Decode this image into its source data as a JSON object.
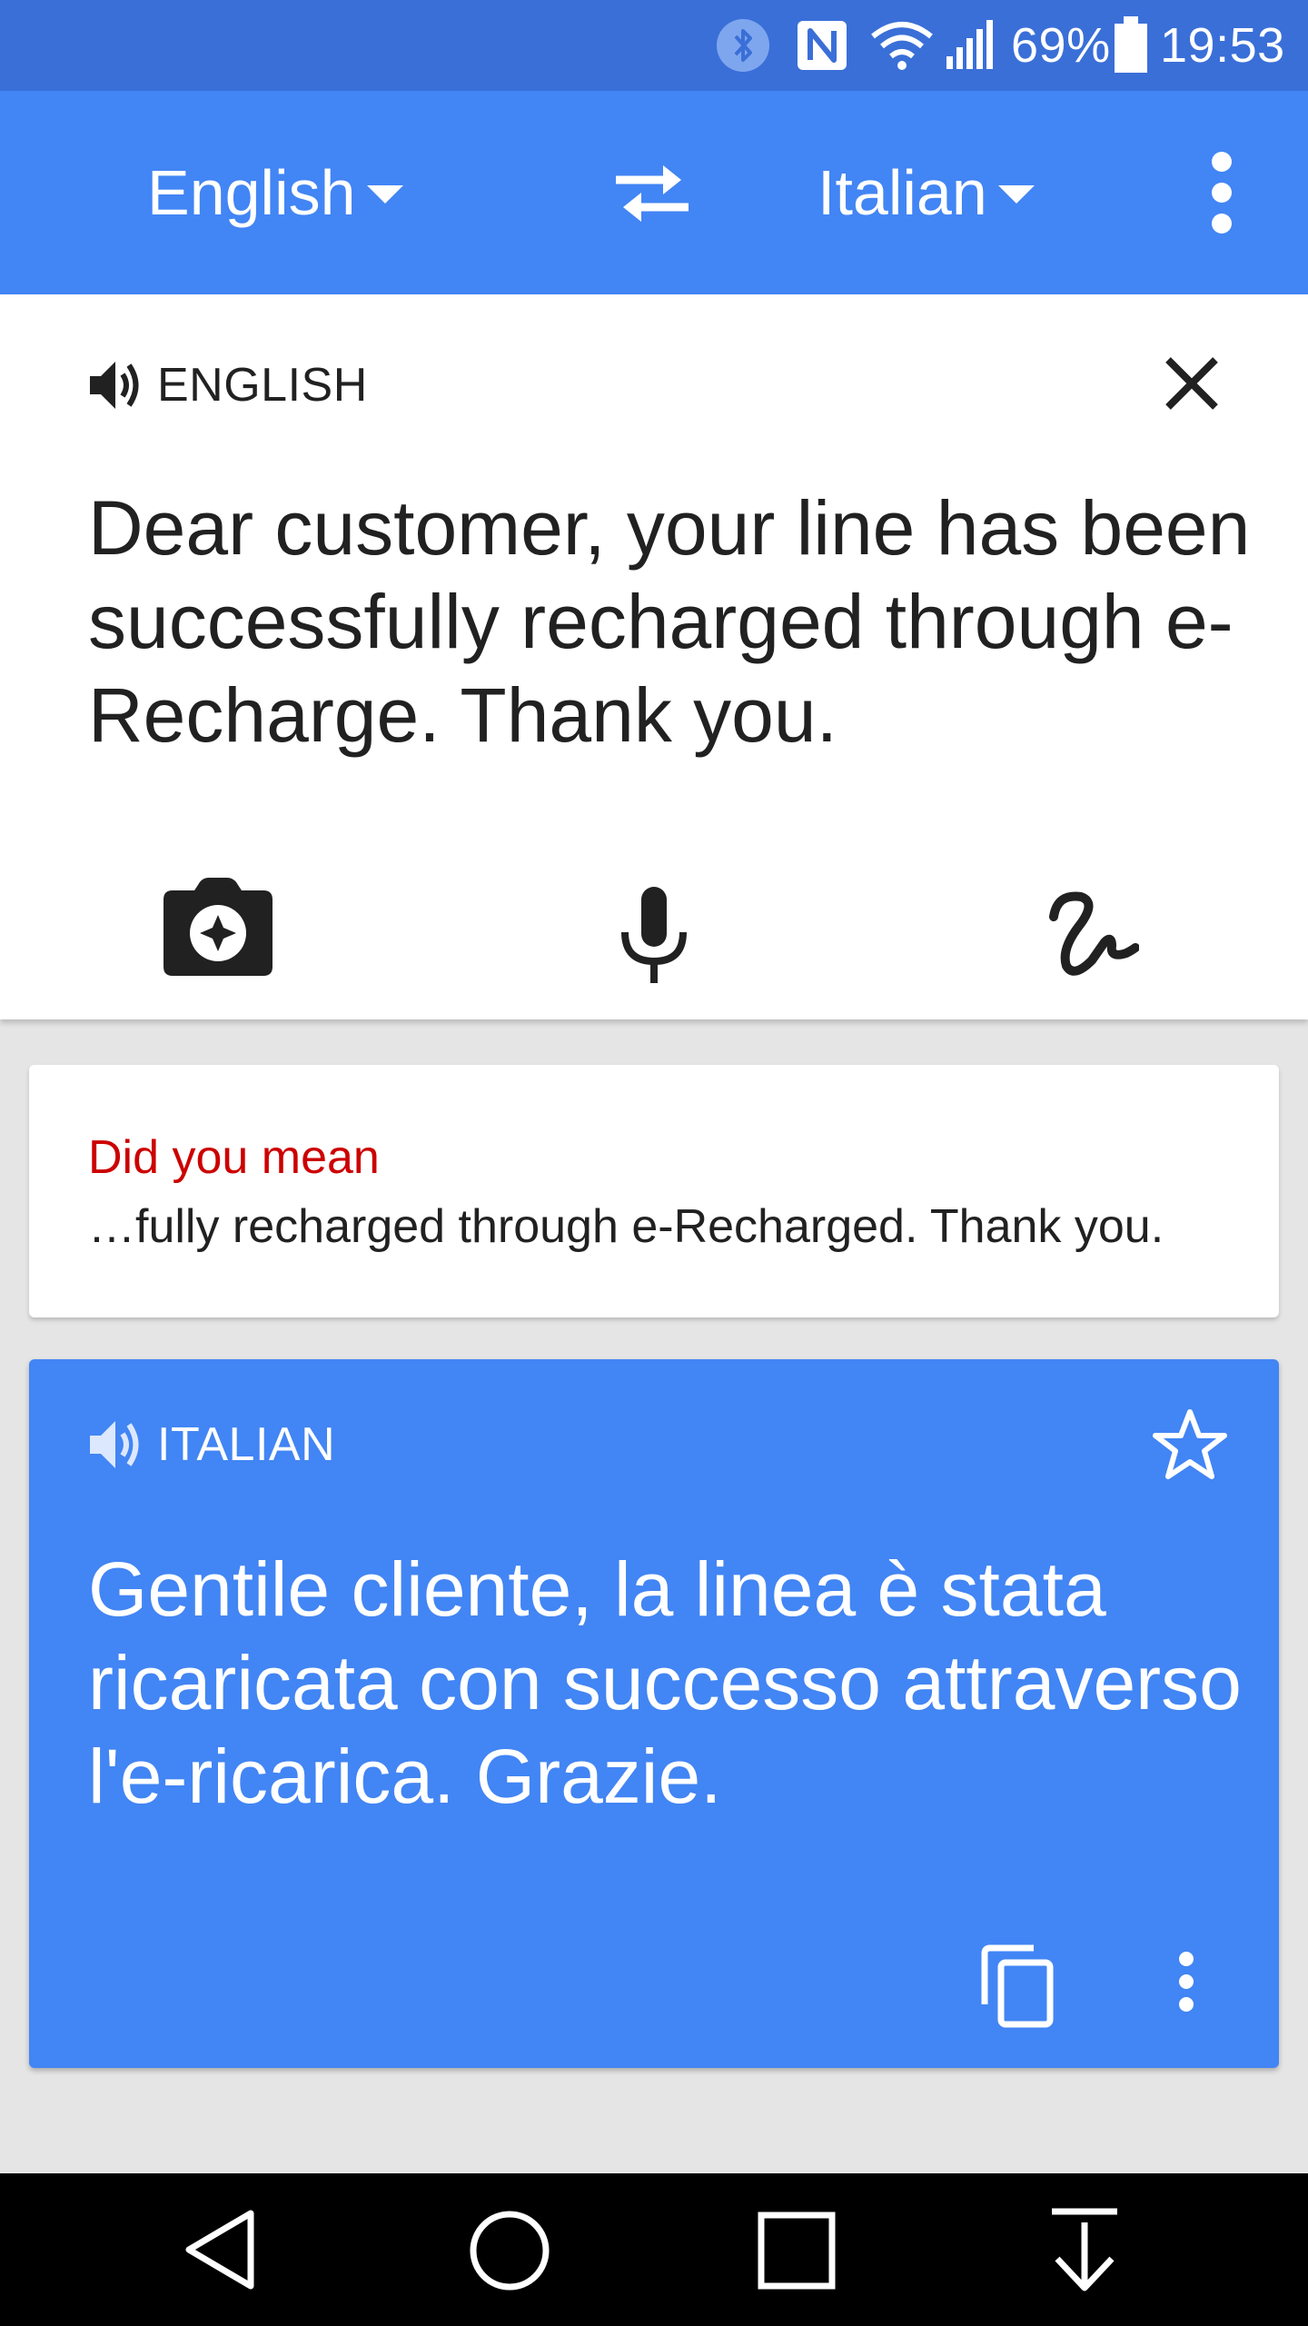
{
  "status_bar": {
    "battery_percent": "69%",
    "time": "19:53",
    "icons": [
      "bluetooth-icon",
      "nfc-icon",
      "wifi-icon",
      "signal-icon",
      "battery-icon"
    ]
  },
  "toolbar": {
    "source_language": "English",
    "target_language": "Italian",
    "icons": [
      "swap-languages-icon",
      "overflow-menu-icon"
    ]
  },
  "input_card": {
    "language_label": "ENGLISH",
    "text": "Dear customer, your  line has been successfully recharged through e-Recharge. Thank you.",
    "tools": [
      "camera-icon",
      "microphone-icon",
      "handwriting-icon"
    ]
  },
  "suggestion": {
    "heading": "Did you mean",
    "text": "…fully recharged through e-Recharged. Thank you."
  },
  "translation_card": {
    "language_label": "ITALIAN",
    "text": "Gentile cliente, la linea è stata ricaricata con successo attraverso l'e-ricarica. Grazie.",
    "icons": [
      "star-icon",
      "copy-icon",
      "more-vert-icon",
      "speaker-icon"
    ]
  },
  "navigation": {
    "icons": [
      "back-icon",
      "home-icon",
      "recents-icon",
      "down-arrow-icon"
    ]
  },
  "colors": {
    "status_bar": "#3a6fd8",
    "app_bar": "#4285f4",
    "suggestion_heading": "#cc0000",
    "text_dark": "#212121"
  }
}
